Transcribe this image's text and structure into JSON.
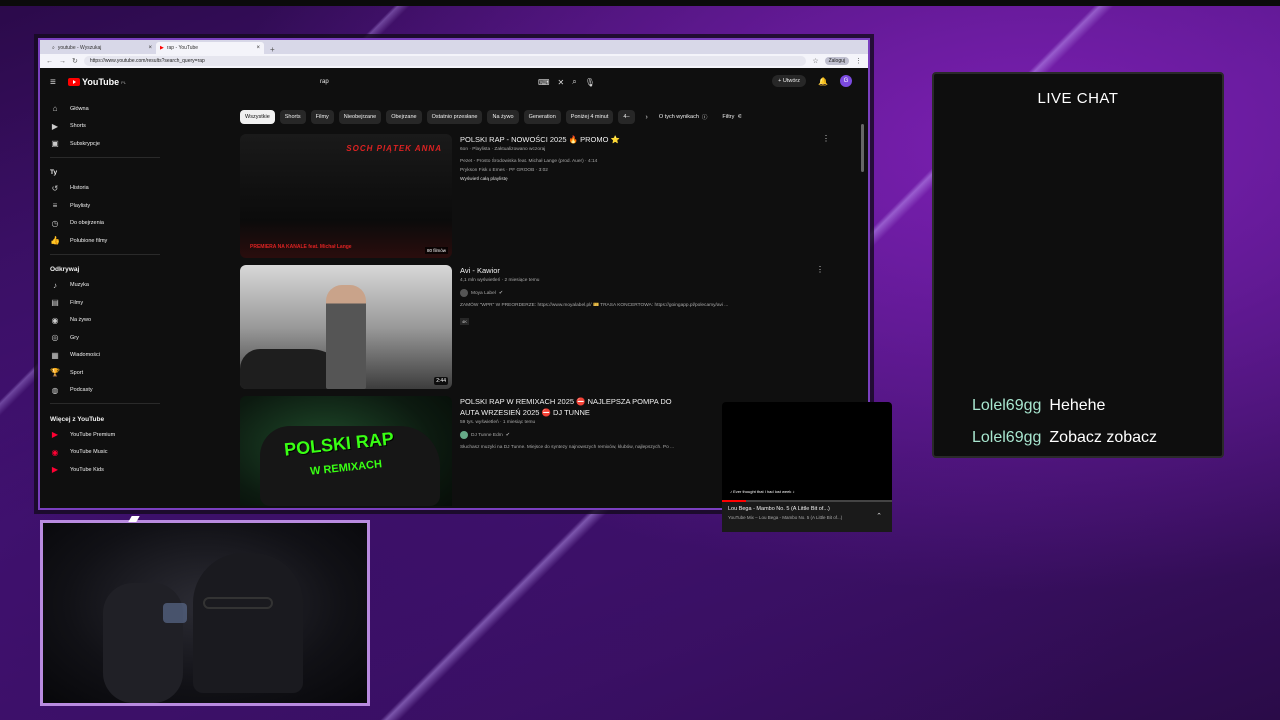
{
  "browser": {
    "tabs": [
      {
        "label": "youtube - Wyszukaj",
        "active": false
      },
      {
        "label": "rap - YouTube",
        "active": true
      }
    ],
    "new_tab": "+",
    "url": "https://www.youtube.com/results?search_query=rap",
    "login": "Zaloguj"
  },
  "yt": {
    "logo": "YouTube",
    "logo_sup": "PL",
    "search_value": "rap",
    "create_label": "Utwórz",
    "avatar_letter": "G"
  },
  "sidebar": {
    "main": [
      {
        "label": "Główna",
        "icon": "home-icon",
        "glyph": "⌂"
      },
      {
        "label": "Shorts",
        "icon": "shorts-icon",
        "glyph": "▶"
      },
      {
        "label": "Subskrypcje",
        "icon": "subscriptions-icon",
        "glyph": "▣"
      }
    ],
    "you_heading": "Ty",
    "you": [
      {
        "label": "Historia",
        "icon": "history-icon",
        "glyph": "↺"
      },
      {
        "label": "Playlisty",
        "icon": "playlists-icon",
        "glyph": "≡"
      },
      {
        "label": "Do obejrzenia",
        "icon": "watch-later-icon",
        "glyph": "◷"
      },
      {
        "label": "Polubione filmy",
        "icon": "like-icon",
        "glyph": "👍"
      }
    ],
    "explore_heading": "Odkrywaj",
    "explore": [
      {
        "label": "Muzyka",
        "icon": "music-icon",
        "glyph": "♪"
      },
      {
        "label": "Filmy",
        "icon": "movies-icon",
        "glyph": "▤"
      },
      {
        "label": "Na żywo",
        "icon": "live-icon",
        "glyph": "◉"
      },
      {
        "label": "Gry",
        "icon": "gaming-icon",
        "glyph": "◎"
      },
      {
        "label": "Wiadomości",
        "icon": "news-icon",
        "glyph": "▦"
      },
      {
        "label": "Sport",
        "icon": "sport-icon",
        "glyph": "🏆"
      },
      {
        "label": "Podcasty",
        "icon": "podcast-icon",
        "glyph": "◍"
      }
    ],
    "more_heading": "Więcej z YouTube",
    "more": [
      {
        "label": "YouTube Premium",
        "icon": "yt-premium-icon",
        "glyph": "▶"
      },
      {
        "label": "YouTube Music",
        "icon": "yt-music-icon",
        "glyph": "◉"
      },
      {
        "label": "YouTube Kids",
        "icon": "yt-kids-icon",
        "glyph": "▶"
      }
    ]
  },
  "chips": [
    "Wszystkie",
    "Shorts",
    "Filmy",
    "Nieobejrzane",
    "Obejrzane",
    "Ostatnio przesłane",
    "Na żywo",
    "Generation",
    "Poniżej 4 minut",
    "4–"
  ],
  "chips_extra": {
    "about": "O tych wynikach",
    "filters": "Filtry"
  },
  "results": [
    {
      "title": "POLSKI RAP - NOWOŚCI 2025 🔥 PROMO ⭐",
      "line1": "6on · Playlista · Zaktualizowano wczoraj",
      "line2": "Pezet - Prosto Środowiska feat. Michał Lange (prod. Auer) · 4:14",
      "line3": "Prykson Fisk x Emes · PF GROOB · 3:02",
      "line4": "Wyświetl całą playlistę",
      "thumb_text": "SOCH PIĄTEK ANNA",
      "thumb_sub": "PREMIERA NA KANALE feat. Michał Lange",
      "count": "80 filmów"
    },
    {
      "title": "Avi - Kawior",
      "line1": "4,1 mln wyświetleń · 2 miesiące temu",
      "channel": "Moya Label",
      "desc": "ZAMÓW \"WPR\" W PREORDERZE: https://www.moyalabel.pl/ 🎫 TRASA KONCERTOWA: https://goingapp.pl/polecamy/avi ...",
      "badge": "4K",
      "duration": "2:44"
    },
    {
      "title": "POLSKI RAP W REMIXACH 2025 ⛔ NAJLEPSZA POMPA DO AUTA WRZESIEŃ 2025 ⛔ DJ TUNNE",
      "line1": "59 tys. wyświetleń · 1 miesiąc temu",
      "channel": "DJ Tunne Edm",
      "desc": "Słuchasz muzyki na DJ Tunne. Miejsce do syntezy najnowszych remixów, klubów, najlepszych. Po ...",
      "thumb_text": "POLSKI RAP",
      "thumb_sub": "W REMIXACH"
    }
  ],
  "miniplayer": {
    "caption": "♪ Ever thought that I had lost week ♪",
    "title": "Lou Bega - Mambo No. 5 (A Little Bit of...)",
    "subtitle": "YouTube Mix – Lou Bega - Mambo No. 5 (A Little Bit of...)",
    "progress": 0.14
  },
  "chat": {
    "title": "LIVE CHAT",
    "messages": [
      {
        "user": "Lolel69gg",
        "text": "Hehehe"
      },
      {
        "user": "Lolel69gg",
        "text": "Zobacz zobacz"
      }
    ]
  }
}
